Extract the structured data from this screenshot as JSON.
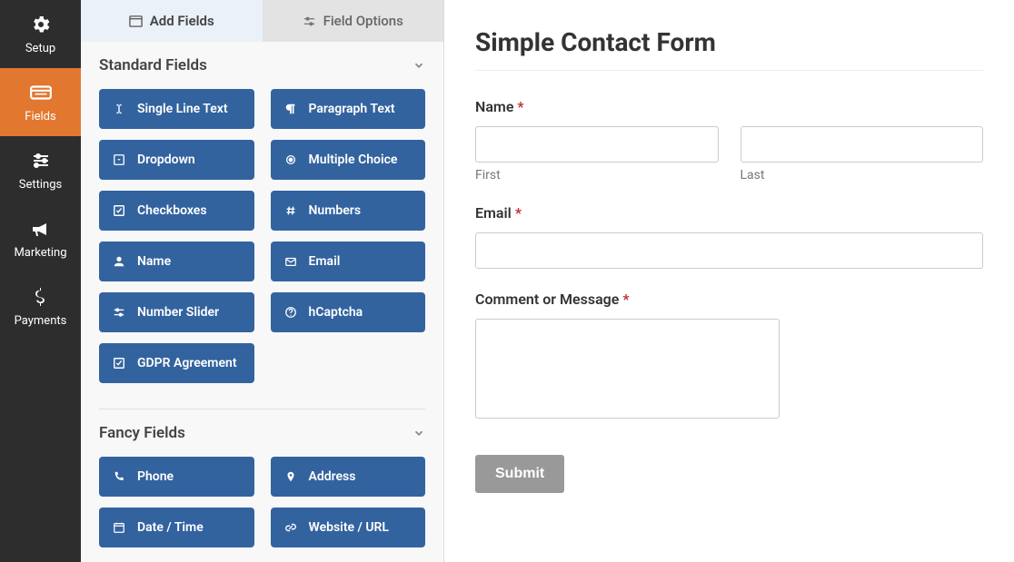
{
  "nav": [
    {
      "label": "Setup",
      "icon": "gear"
    },
    {
      "label": "Fields",
      "icon": "fields",
      "active": true
    },
    {
      "label": "Settings",
      "icon": "sliders"
    },
    {
      "label": "Marketing",
      "icon": "bullhorn"
    },
    {
      "label": "Payments",
      "icon": "dollar"
    }
  ],
  "tabs": {
    "add": "Add Fields",
    "options": "Field Options"
  },
  "sections": {
    "standard": {
      "title": "Standard Fields",
      "fields": [
        {
          "label": "Single Line Text",
          "icon": "text-cursor"
        },
        {
          "label": "Paragraph Text",
          "icon": "paragraph"
        },
        {
          "label": "Dropdown",
          "icon": "caret-square"
        },
        {
          "label": "Multiple Choice",
          "icon": "radio-dot"
        },
        {
          "label": "Checkboxes",
          "icon": "check-square"
        },
        {
          "label": "Numbers",
          "icon": "hash"
        },
        {
          "label": "Name",
          "icon": "user"
        },
        {
          "label": "Email",
          "icon": "envelope"
        },
        {
          "label": "Number Slider",
          "icon": "sliders-h"
        },
        {
          "label": "hCaptcha",
          "icon": "question"
        },
        {
          "label": "GDPR Agreement",
          "icon": "check-square"
        }
      ]
    },
    "fancy": {
      "title": "Fancy Fields",
      "fields": [
        {
          "label": "Phone",
          "icon": "phone"
        },
        {
          "label": "Address",
          "icon": "map-pin"
        },
        {
          "label": "Date / Time",
          "icon": "calendar"
        },
        {
          "label": "Website / URL",
          "icon": "link"
        }
      ]
    }
  },
  "form": {
    "title": "Simple Contact Form",
    "name_label": "Name",
    "first_sub": "First",
    "last_sub": "Last",
    "email_label": "Email",
    "message_label": "Comment or Message",
    "submit": "Submit"
  }
}
